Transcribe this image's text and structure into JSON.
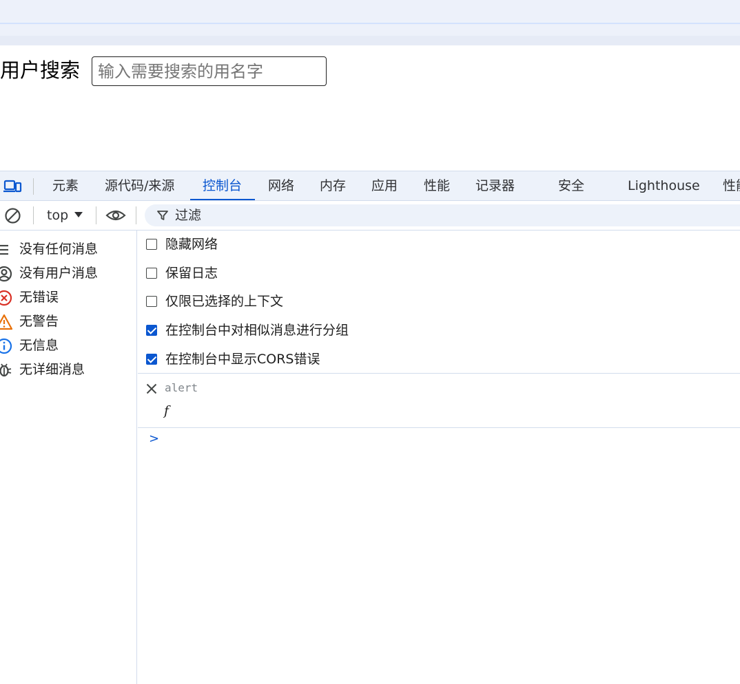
{
  "page": {
    "search_label": "用户搜索",
    "search_placeholder": "输入需要搜索的用名字",
    "search_value": ""
  },
  "devtools": {
    "tabs": [
      {
        "label": "元素",
        "active": false
      },
      {
        "label": "源代码/来源",
        "active": false
      },
      {
        "label": "控制台",
        "active": true
      },
      {
        "label": "网络",
        "active": false
      },
      {
        "label": "内存",
        "active": false
      },
      {
        "label": "应用",
        "active": false
      },
      {
        "label": "性能",
        "active": false
      },
      {
        "label": "记录器",
        "active": false
      },
      {
        "label": "安全",
        "active": false
      },
      {
        "label": "Lighthouse",
        "active": false
      },
      {
        "label": "性能",
        "active": false
      }
    ],
    "toolbar": {
      "context": "top",
      "filter_label": "过滤"
    },
    "sidebar": [
      {
        "label": "没有任何消息",
        "icon": "list-icon"
      },
      {
        "label": "没有用户消息",
        "icon": "user-icon"
      },
      {
        "label": "无错误",
        "icon": "error-icon"
      },
      {
        "label": "无警告",
        "icon": "warning-icon"
      },
      {
        "label": "无信息",
        "icon": "info-icon"
      },
      {
        "label": "无详细消息",
        "icon": "bug-icon"
      }
    ],
    "settings": [
      {
        "label": "隐藏网络",
        "checked": false
      },
      {
        "label": "保留日志",
        "checked": false
      },
      {
        "label": "仅限已选择的上下文",
        "checked": false
      },
      {
        "label": "在控制台中对相似消息进行分组",
        "checked": true
      },
      {
        "label": "在控制台中显示CORS错误",
        "checked": true
      }
    ],
    "console_entry": {
      "expression": "alert",
      "result": "f"
    },
    "prompt": ">"
  },
  "colors": {
    "accent": "#0b57d0",
    "error": "#d93025",
    "warning": "#e8710a",
    "info": "#1a73e8"
  }
}
